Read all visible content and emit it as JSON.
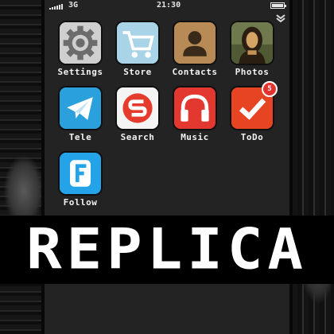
{
  "status_bar": {
    "carrier": "3G",
    "time": "21:30"
  },
  "apps": [
    {
      "label": "Settings",
      "icon": "gear-icon",
      "color": "#c9c9c9"
    },
    {
      "label": "Store",
      "icon": "cart-icon",
      "color": "#a9d3e6"
    },
    {
      "label": "Contacts",
      "icon": "contact-icon",
      "color": "#b88a55"
    },
    {
      "label": "Photos",
      "icon": "portrait-icon",
      "color": "#6b5a3a"
    },
    {
      "label": "Tele",
      "icon": "paper-plane-icon",
      "color": "#2aa0dc"
    },
    {
      "label": "Search",
      "icon": "s-logo-icon",
      "color": "#f4f4f4"
    },
    {
      "label": "Music",
      "icon": "headphones-icon",
      "color": "#e2382f"
    },
    {
      "label": "ToDo",
      "icon": "checkmark-icon",
      "color": "#e64422",
      "badge": "5"
    },
    {
      "label": "Follow",
      "icon": "f-logo-icon",
      "color": "#25a3e8"
    }
  ],
  "banner": {
    "text": "REPLICA"
  }
}
